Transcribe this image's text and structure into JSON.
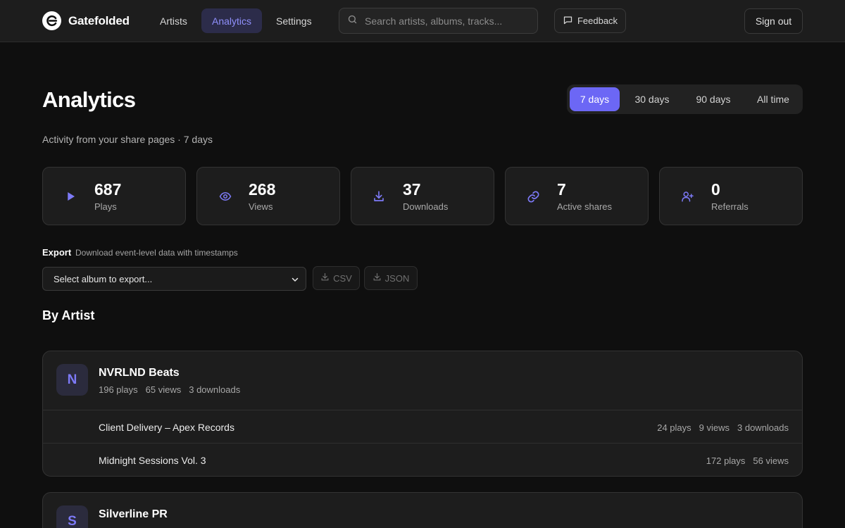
{
  "app": {
    "name": "Gatefolded",
    "logo_icon": "gatefold-logo-icon"
  },
  "nav": {
    "items": [
      {
        "label": "Artists",
        "active": false
      },
      {
        "label": "Analytics",
        "active": true
      },
      {
        "label": "Settings",
        "active": false
      }
    ]
  },
  "search": {
    "placeholder": "Search artists, albums, tracks...",
    "value": "",
    "icon": "search-icon"
  },
  "feedback": {
    "label": "Feedback",
    "icon": "message-square-icon"
  },
  "signout": {
    "label": "Sign out"
  },
  "header": {
    "title": "Analytics",
    "subtitle": "Activity from your share pages · 7 days"
  },
  "range": {
    "options": [
      "7 days",
      "30 days",
      "90 days",
      "All time"
    ],
    "selected": "7 days"
  },
  "stats": [
    {
      "value": "687",
      "label": "Plays",
      "icon": "play-icon"
    },
    {
      "value": "268",
      "label": "Views",
      "icon": "eye-icon"
    },
    {
      "value": "37",
      "label": "Downloads",
      "icon": "download-icon"
    },
    {
      "value": "7",
      "label": "Active shares",
      "icon": "link-icon"
    },
    {
      "value": "0",
      "label": "Referrals",
      "icon": "user-plus-icon"
    }
  ],
  "export": {
    "title": "Export",
    "description": "Download event-level data with timestamps",
    "select_value": "Select album to export...",
    "csv_label": "CSV",
    "json_label": "JSON"
  },
  "by_artist": {
    "title": "By Artist",
    "artists": [
      {
        "initial": "N",
        "name": "NVRLND Beats",
        "stats": [
          "196 plays",
          "65 views",
          "3 downloads"
        ],
        "albums": [
          {
            "name": "Client Delivery – Apex Records",
            "stats": [
              "24 plays",
              "9 views",
              "3 downloads"
            ]
          },
          {
            "name": "Midnight Sessions Vol. 3",
            "stats": [
              "172 plays",
              "56 views"
            ]
          }
        ]
      },
      {
        "initial": "S",
        "name": "Silverline PR"
      }
    ]
  },
  "colors": {
    "accent": "#6c67f5",
    "accent_text": "#8f8ffb",
    "background": "#0f0f0f",
    "card": "#1d1d1d"
  }
}
